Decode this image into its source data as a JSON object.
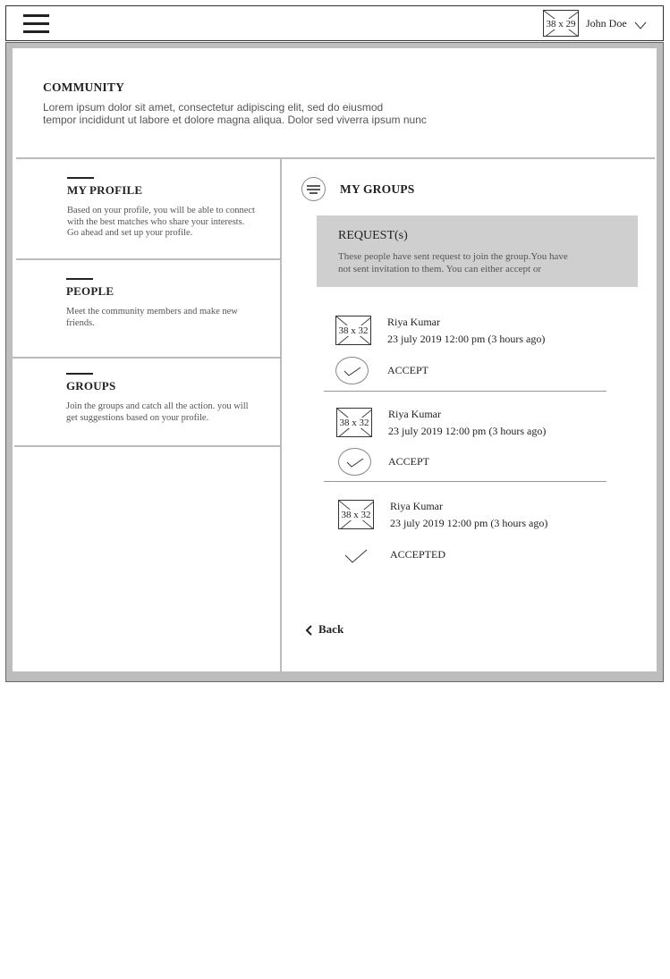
{
  "topbar": {
    "avatar_placeholder": "38 x 29",
    "user_name": "John Doe"
  },
  "community": {
    "title": "COMMUNITY",
    "description_line1": "Lorem ipsum dolor sit amet, consectetur adipiscing elit, sed do eiusmod",
    "description_line2": "tempor incididunt ut labore et dolore magna aliqua. Dolor sed viverra ipsum nunc"
  },
  "sidebar": {
    "items": [
      {
        "title": "MY PROFILE",
        "line1": "Based on your profile, you will  be able to connect",
        "line2": "with the best matches who share your interests.",
        "line3": "Go ahead and set up your profile."
      },
      {
        "title": "PEOPLE",
        "line1": "Meet the community members and make new",
        "line2": "friends."
      },
      {
        "title": "GROUPS",
        "line1": "Join the groups and catch all the action. you will",
        "line2": "get suggestions based on your profile."
      }
    ]
  },
  "main": {
    "title": "MY GROUPS",
    "requests_box": {
      "title": "REQUEST(s)",
      "line1": "These people have sent request to join the group.You have",
      "line2": "not sent invitation to them. You can either accept or"
    },
    "requests": [
      {
        "avatar": "38 x 32",
        "name": "Riya Kumar",
        "date": "23 july 2019 12:00 pm (3 hours ago)",
        "action": "ACCEPT"
      },
      {
        "avatar": "38 x 32",
        "name": "Riya Kumar",
        "date": "23 july 2019 12:00 pm (3 hours ago)",
        "action": "ACCEPT"
      },
      {
        "avatar": "38 x 32",
        "name": "Riya Kumar",
        "date": "23 july 2019 12:00 pm (3 hours ago)",
        "action": "ACCEPTED"
      }
    ],
    "back_label": "Back"
  }
}
